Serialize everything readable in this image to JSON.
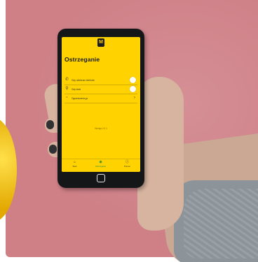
{
  "app": {
    "logo_glyph": "M",
    "title": "Ostrzeganie"
  },
  "settings": [
    {
      "label": "Gdy odbieram telefonie",
      "icon": "phone-icon",
      "control": "toggle"
    },
    {
      "label": "Gdy idzie",
      "icon": "location-icon",
      "control": "toggle"
    },
    {
      "label": "Ograniczenia go",
      "icon": "bell-icon",
      "control": "chevron"
    }
  ],
  "version": "Wersja 2.0.1",
  "tabs": [
    {
      "label": "Start",
      "icon": "home-icon",
      "active": false
    },
    {
      "label": "Ostrzeganie",
      "icon": "alert-icon",
      "active": true
    },
    {
      "label": "Pomoc",
      "icon": "help-icon",
      "active": false
    }
  ],
  "colors": {
    "backdrop": "#cf8087",
    "screen": "#ffd200",
    "accent_active": "#1f8a3b",
    "phone_body": "#151617"
  }
}
